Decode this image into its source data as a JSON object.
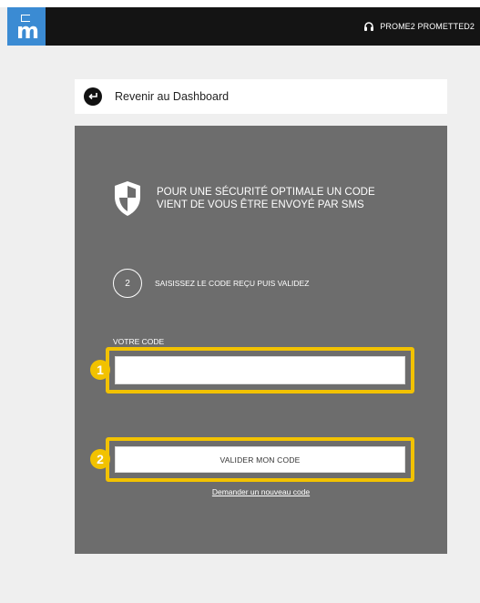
{
  "topbar": {
    "user_name": "PROME2 PROMETTED2",
    "logo_icon": "brand-m-logo-icon",
    "user_icon": "headset-icon",
    "accent": "#3b8bd3"
  },
  "back": {
    "label": "Revenir au Dashboard",
    "icon": "back-arrow-icon"
  },
  "panel": {
    "background": "#6d6d6d",
    "headline": "POUR UNE SÉCURITÉ OPTIMALE UN CODE VIENT DE VOUS ÊTRE ENVOYÉ PAR SMS",
    "headline_icon": "shield-icon",
    "step_number": "2",
    "step_text": "SAISISSEZ LE CODE REÇU PUIS VALIDEZ",
    "code_label": "VOTRE CODE",
    "code_value": "",
    "submit_label": "VALIDER MON CODE",
    "resend_link": "Demander un nouveau code"
  },
  "annotations": {
    "highlight_color": "#f2c200",
    "badge_1": "1",
    "badge_2": "2"
  }
}
